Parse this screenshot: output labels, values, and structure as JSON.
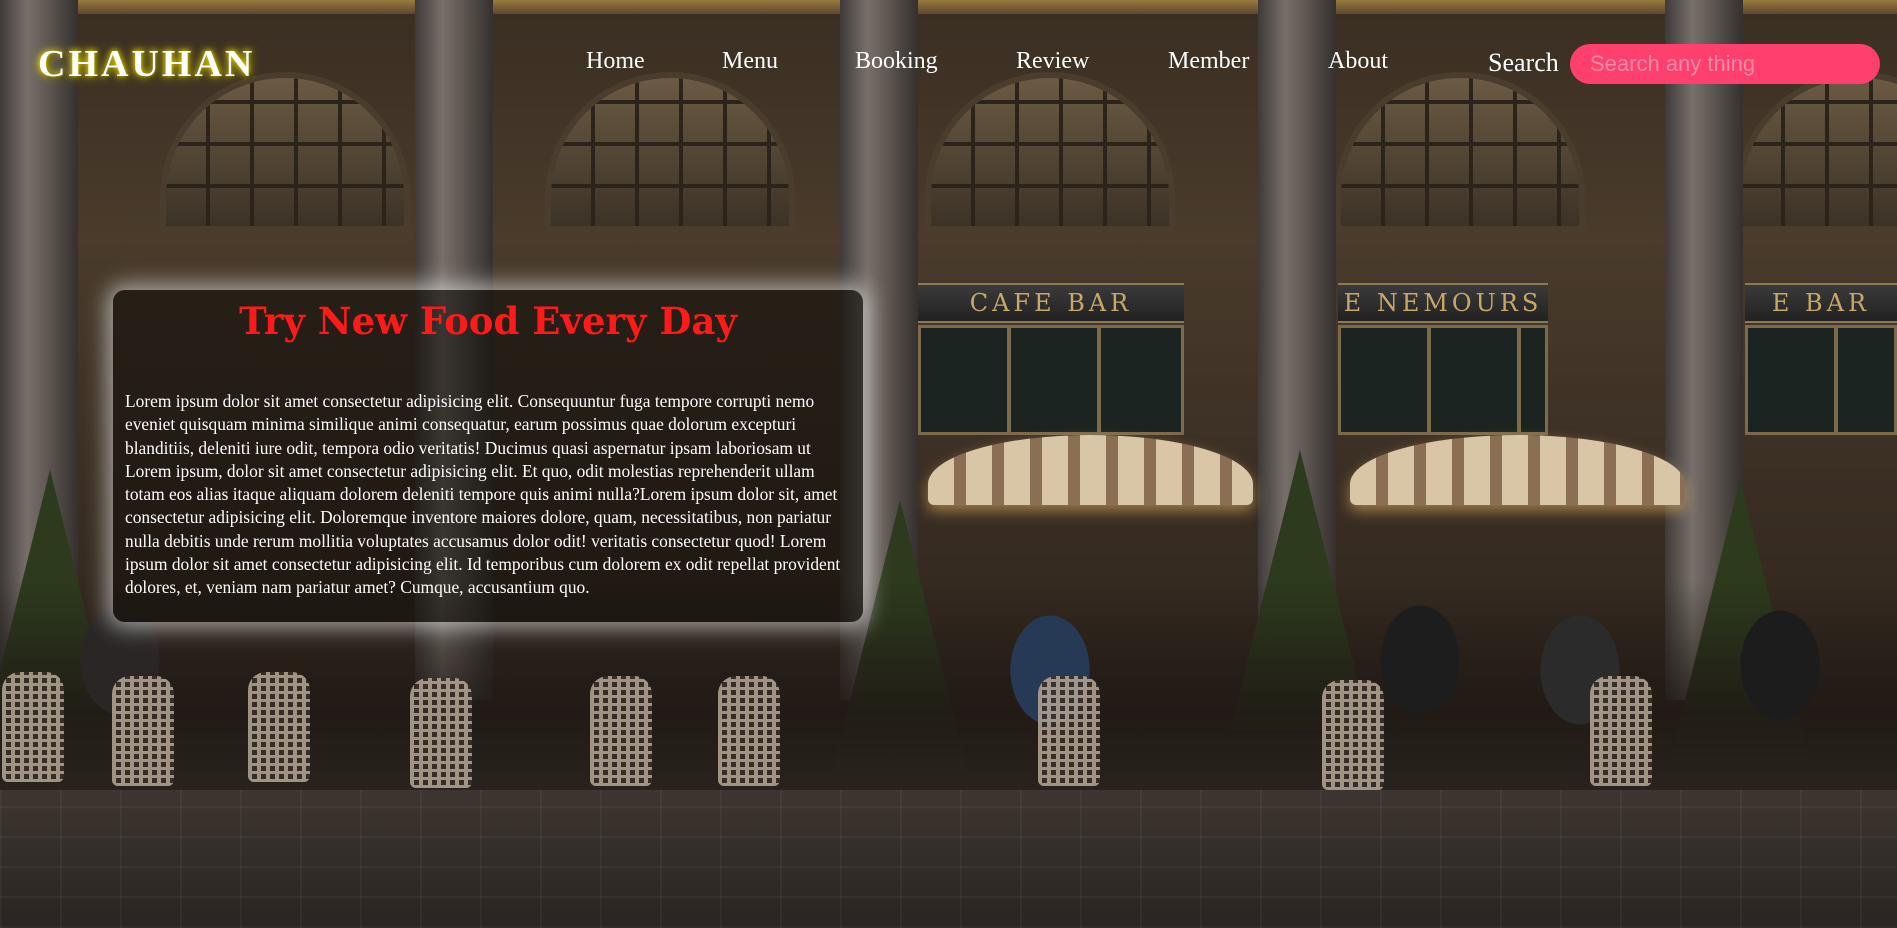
{
  "brand": {
    "logo_text": "CHAUHAN",
    "accent_color": "#ff3f6e",
    "title_color": "#ff1a1a",
    "logo_glow_color": "#f3e400"
  },
  "nav": {
    "items": [
      {
        "label": "Home"
      },
      {
        "label": "Menu"
      },
      {
        "label": "Booking"
      },
      {
        "label": "Review"
      },
      {
        "label": "Member"
      },
      {
        "label": "About"
      }
    ],
    "search_label": "Search",
    "search_placeholder": "Search any thing"
  },
  "hero": {
    "title": "Try New Food Every Day",
    "body": "Lorem ipsum dolor sit amet consectetur adipisicing elit. Consequuntur fuga tempore corrupti nemo eveniet quisquam minima similique animi consequatur, earum possimus quae dolorum excepturi blanditiis, deleniti iure odit, tempora odio veritatis! Ducimus quasi aspernatur ipsam laboriosam ut Lorem ipsum, dolor sit amet consectetur adipisicing elit. Et quo, odit molestias reprehenderit ullam totam eos alias itaque aliquam dolorem deleniti tempore quis animi nulla?Lorem ipsum dolor sit, amet consectetur adipisicing elit. Doloremque inventore maiores dolore, quam, necessitatibus, non pariatur nulla debitis unde rerum mollitia voluptates accusamus dolor odit! veritatis consectetur quod! Lorem ipsum dolor sit amet consectetur adipisicing elit. Id temporibus cum dolorem ex odit repellat provident dolores, et, veniam nam pariatur amet? Cumque, accusantium quo."
  },
  "background_signs": [
    "CAFE  BAR",
    "E NEMOURS",
    "E  BAR"
  ]
}
